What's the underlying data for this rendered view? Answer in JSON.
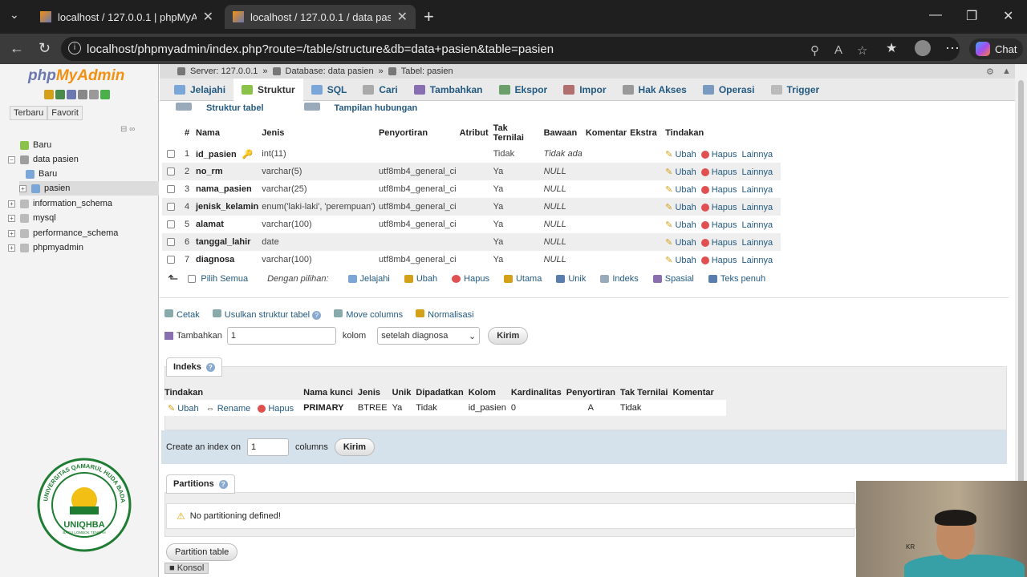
{
  "browser": {
    "tabs": [
      {
        "title": "localhost / 127.0.0.1 | phpMyAdmin"
      },
      {
        "title": "localhost / 127.0.0.1 / data pasien"
      }
    ],
    "url": "localhost/phpmyadmin/index.php?route=/table/structure&db=data+pasien&table=pasien",
    "chat_label": "Chat"
  },
  "nav": {
    "logo_php": "php",
    "logo_myadmin": "MyAdmin",
    "tabs": [
      "Terbaru",
      "Favorit"
    ],
    "tree": [
      {
        "label": "Baru",
        "level": 0
      },
      {
        "label": "data pasien",
        "level": 0
      },
      {
        "label": "Baru",
        "level": 1
      },
      {
        "label": "pasien",
        "level": 1
      },
      {
        "label": "information_schema",
        "level": 0
      },
      {
        "label": "mysql",
        "level": 0
      },
      {
        "label": "performance_schema",
        "level": 0
      },
      {
        "label": "phpmyadmin",
        "level": 0
      }
    ],
    "university_seal": {
      "name": "UNIQHBA",
      "arc_text": "UNIVERSITAS QAMARUL HUDA BADARUDDIN",
      "sub": "BAGU LOMBOK TENGAH"
    }
  },
  "breadcrumb": {
    "server": "Server: 127.0.0.1",
    "database": "Database: data pasien",
    "table": "Tabel: pasien"
  },
  "top_tabs": [
    "Jelajahi",
    "Struktur",
    "SQL",
    "Cari",
    "Tambahkan",
    "Ekspor",
    "Impor",
    "Hak Akses",
    "Operasi",
    "Trigger"
  ],
  "sub_tabs": [
    "Struktur tabel",
    "Tampilan hubungan"
  ],
  "structure": {
    "headers": [
      "#",
      "Nama",
      "Jenis",
      "Penyortiran",
      "Atribut",
      "Tak Ternilai",
      "Bawaan",
      "Komentar",
      "Ekstra",
      "Tindakan"
    ],
    "rows": [
      {
        "no": "1",
        "name": "id_pasien",
        "type": "int(11)",
        "collation": "",
        "null": "Tidak",
        "default": "Tidak ada"
      },
      {
        "no": "2",
        "name": "no_rm",
        "type": "varchar(5)",
        "collation": "utf8mb4_general_ci",
        "null": "Ya",
        "default": "NULL"
      },
      {
        "no": "3",
        "name": "nama_pasien",
        "type": "varchar(25)",
        "collation": "utf8mb4_general_ci",
        "null": "Ya",
        "default": "NULL"
      },
      {
        "no": "4",
        "name": "jenisk_kelamin",
        "type": "enum('laki-laki', 'perempuan')",
        "collation": "utf8mb4_general_ci",
        "null": "Ya",
        "default": "NULL"
      },
      {
        "no": "5",
        "name": "alamat",
        "type": "varchar(100)",
        "collation": "utf8mb4_general_ci",
        "null": "Ya",
        "default": "NULL"
      },
      {
        "no": "6",
        "name": "tanggal_lahir",
        "type": "date",
        "collation": "",
        "null": "Ya",
        "default": "NULL"
      },
      {
        "no": "7",
        "name": "diagnosa",
        "type": "varchar(100)",
        "collation": "utf8mb4_general_ci",
        "null": "Ya",
        "default": "NULL"
      }
    ],
    "actions": {
      "edit": "Ubah",
      "drop": "Hapus",
      "more": "Lainnya"
    }
  },
  "bulk": {
    "check_all": "Pilih Semua",
    "with_selected": "Dengan pilihan:",
    "items": [
      "Jelajahi",
      "Ubah",
      "Hapus",
      "Utama",
      "Unik",
      "Indeks",
      "Spasial",
      "Teks penuh"
    ]
  },
  "tools": {
    "items": [
      "Cetak",
      "Usulkan struktur tabel",
      "Move columns",
      "Normalisasi"
    ],
    "add_label": "Tambahkan",
    "add_value": "1",
    "kolom_label": "kolom",
    "position": "setelah diagnosa",
    "submit": "Kirim"
  },
  "indexes": {
    "legend": "Indeks",
    "headers": [
      "Tindakan",
      "Nama kunci",
      "Jenis",
      "Unik",
      "Dipadatkan",
      "Kolom",
      "Kardinalitas",
      "Penyortiran",
      "Tak Ternilai",
      "Komentar"
    ],
    "row": {
      "edit": "Ubah",
      "rename": "Rename",
      "drop": "Hapus",
      "key": "PRIMARY",
      "type": "BTREE",
      "unique": "Ya",
      "packed": "Tidak",
      "column": "id_pasien",
      "cardinality": "0",
      "collation": "A",
      "null": "Tidak",
      "comment": ""
    },
    "create_label": "Create an index on",
    "create_value": "1",
    "columns_label": "columns",
    "submit": "Kirim"
  },
  "partitions": {
    "legend": "Partitions",
    "message": "No partitioning defined!",
    "button": "Partition table"
  },
  "console": {
    "label": "Konsol"
  },
  "webcam_caption": "KR"
}
